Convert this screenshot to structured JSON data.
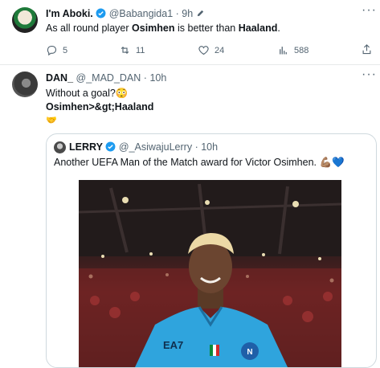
{
  "tweet1": {
    "display_name": "I'm Aboki.",
    "handle": "@Babangida1",
    "dot": "·",
    "time": "9h",
    "text_pre": "As all round player ",
    "text_bold1": "Osimhen",
    "text_mid": " is better than ",
    "text_bold2": "Haaland",
    "text_post": ".",
    "replies": "5",
    "retweets": "11",
    "likes": "24",
    "views": "588"
  },
  "tweet2": {
    "display_name": "DAN_",
    "handle": "@_MAD_DAN",
    "dot": "·",
    "time": "10h",
    "line1": "Without a goal?",
    "line1_emoji": "😳",
    "line2_bold1": "Osimhen",
    "line2_sep": ">&gt;",
    "line2_bold2": "Haaland",
    "line3_emoji": "🤝"
  },
  "quote": {
    "display_name": "LERRY",
    "handle": "@_AsiwajuLerry",
    "dot": "·",
    "time": "10h",
    "text": "Another UEFA Man of the Match award for Victor Osimhen.",
    "emoji1": "💪🏽",
    "emoji2": "💙",
    "jersey_brand": "EA7"
  },
  "colors": {
    "verified_blue": "#1d9bf0",
    "text": "#0f1419",
    "muted": "#536471",
    "jersey": "#2fa4dd"
  }
}
